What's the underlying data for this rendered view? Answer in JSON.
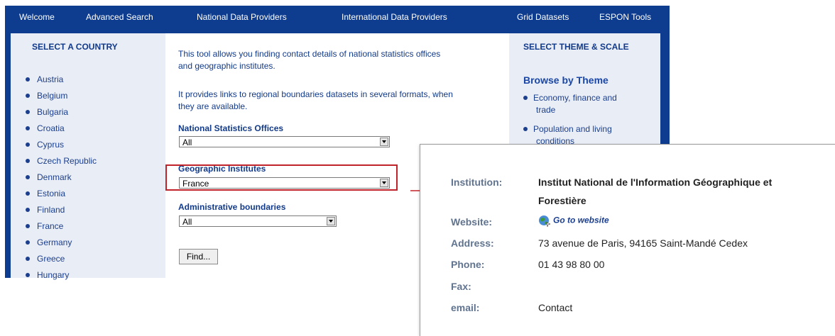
{
  "nav": {
    "items": [
      "Welcome",
      "Advanced Search",
      "National Data Providers",
      "International Data Providers",
      "Grid Datasets",
      "ESPON Tools"
    ]
  },
  "countries": {
    "title": "SELECT A COUNTRY",
    "items": [
      "Austria",
      "Belgium",
      "Bulgaria",
      "Croatia",
      "Cyprus",
      "Czech Republic",
      "Denmark",
      "Estonia",
      "Finland",
      "France",
      "Germany",
      "Greece",
      "Hungary"
    ]
  },
  "main": {
    "intro1_line1": "This tool allows you finding contact details of national statistics offices",
    "intro1_line2": "and geographic institutes.",
    "intro2_line1": "It provides links to regional boundaries datasets in several formats, when",
    "intro2_line2": "they are available.",
    "nso_label": "National Statistics Offices",
    "nso_value": "All",
    "geo_label": "Geographic Institutes",
    "geo_value": "France",
    "admin_label": "Administrative boundaries",
    "admin_value": "All",
    "find_label": "Find..."
  },
  "theme": {
    "title": "SELECT THEME & SCALE",
    "browse_label": "Browse by Theme",
    "items": [
      {
        "line1": "Economy, finance and",
        "line2": "trade"
      },
      {
        "line1": "Population and living",
        "line2": "conditions"
      }
    ]
  },
  "detail": {
    "institution_label": "Institution:",
    "institution_line1": "Institut National de l'Information Géographique et",
    "institution_line2": "Forestière",
    "website_label": "Website:",
    "website_link": "Go to website",
    "address_label": "Address:",
    "address_value": "73 avenue de Paris, 94165 Saint-Mandé Cedex",
    "phone_label": "Phone:",
    "phone_value": "01 43 98 80 00",
    "fax_label": "Fax:",
    "fax_value": "",
    "email_label": "email:",
    "email_value": "Contact"
  },
  "colors": {
    "brand": "#0e3c8f",
    "panel": "#e9edf5",
    "highlight": "#c0232a"
  },
  "icons": {
    "website": "globe-link-icon",
    "connector": "arrow-right-icon"
  }
}
